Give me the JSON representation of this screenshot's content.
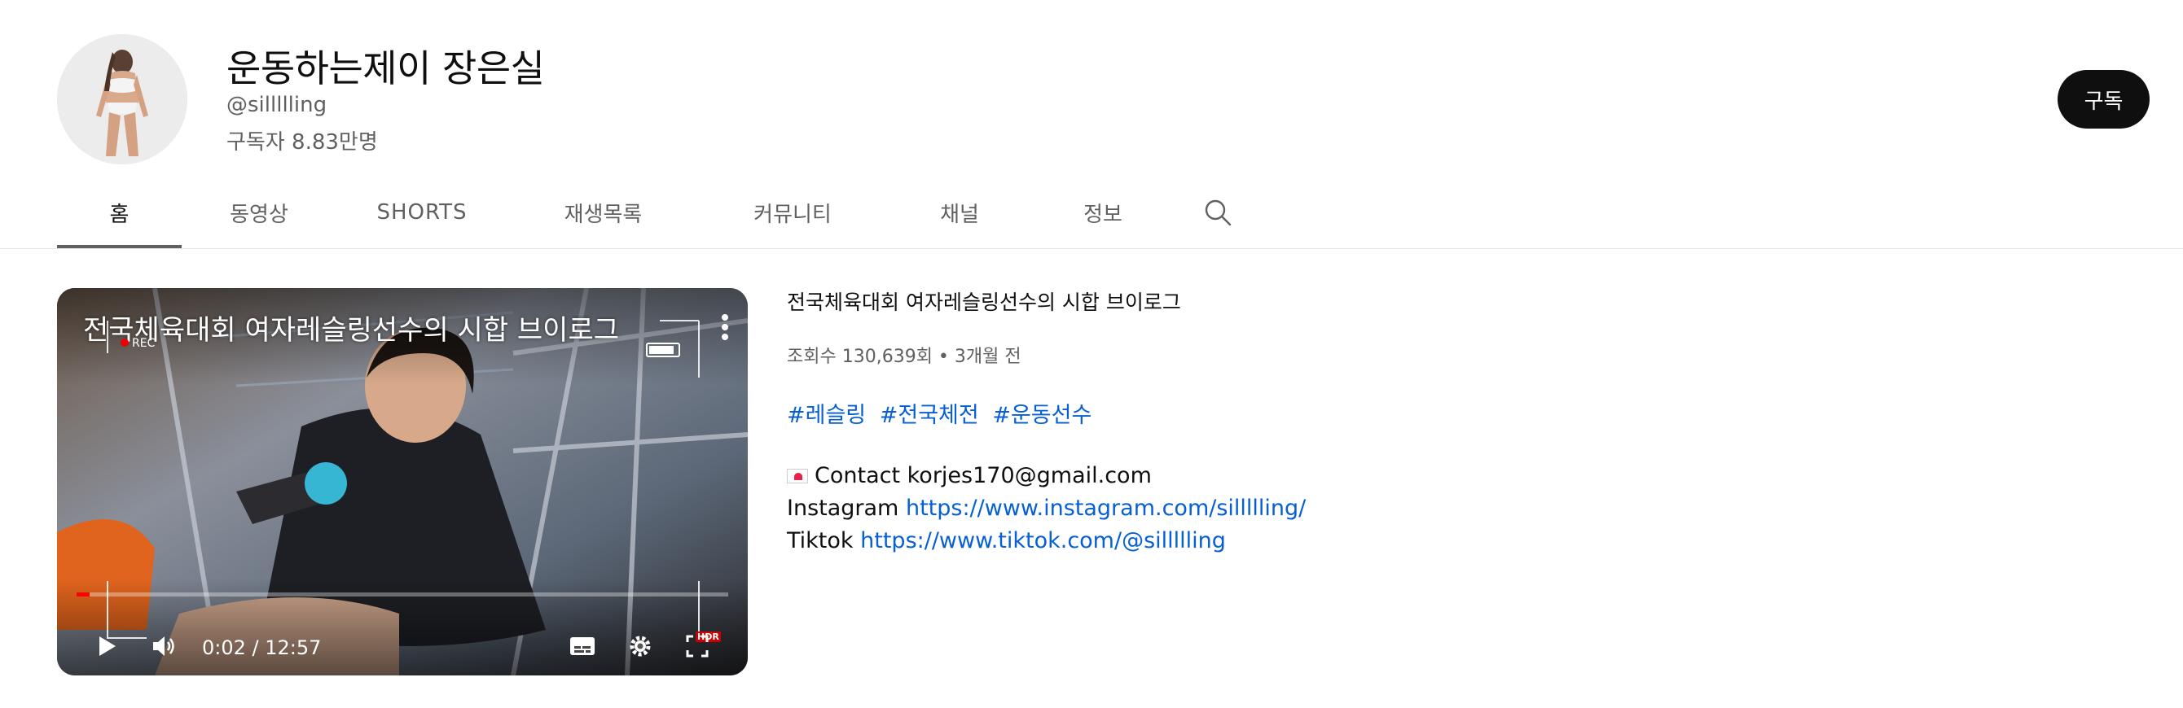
{
  "channel": {
    "name": "운동하는제이 장은실",
    "handle": "@sillllling",
    "subscribers": "구독자 8.83만명",
    "subscribe_label": "구독"
  },
  "tabs": [
    {
      "label": "홈",
      "active": true
    },
    {
      "label": "동영상"
    },
    {
      "label": "SHORTS"
    },
    {
      "label": "재생목록"
    },
    {
      "label": "커뮤니티"
    },
    {
      "label": "채널"
    },
    {
      "label": "정보"
    }
  ],
  "search_icon": "search-icon",
  "player": {
    "overlay_title": "전국체육대회 여자레슬링선수의 시합 브이로그",
    "rec_label": "REC",
    "time": "0:02 / 12:57",
    "progress": 0.003,
    "hdr_label": "HDR",
    "icons": [
      "play-icon",
      "volume-icon",
      "subtitles-icon",
      "settings-icon",
      "fullscreen-icon",
      "more-vert-icon"
    ]
  },
  "video": {
    "title": "전국체육대회 여자레슬링선수의 시합 브이로그",
    "meta": "조회수 130,639회 • 3개월 전",
    "hashtags": [
      "#레슬링",
      "#전국체전",
      "#운동선수"
    ],
    "contact_label": "Contact korjes170@gmail.com",
    "instagram_label": "Instagram",
    "instagram_url": "https://www.instagram.com/sillllling/",
    "tiktok_label": "Tiktok",
    "tiktok_url": "https://www.tiktok.com/@sillllling"
  },
  "colors": {
    "text_primary": "#0f0f0f",
    "text_secondary": "#606060",
    "link": "#065fd4",
    "subscribe_bg": "#0f0f0f",
    "progress": "#ff0000"
  }
}
